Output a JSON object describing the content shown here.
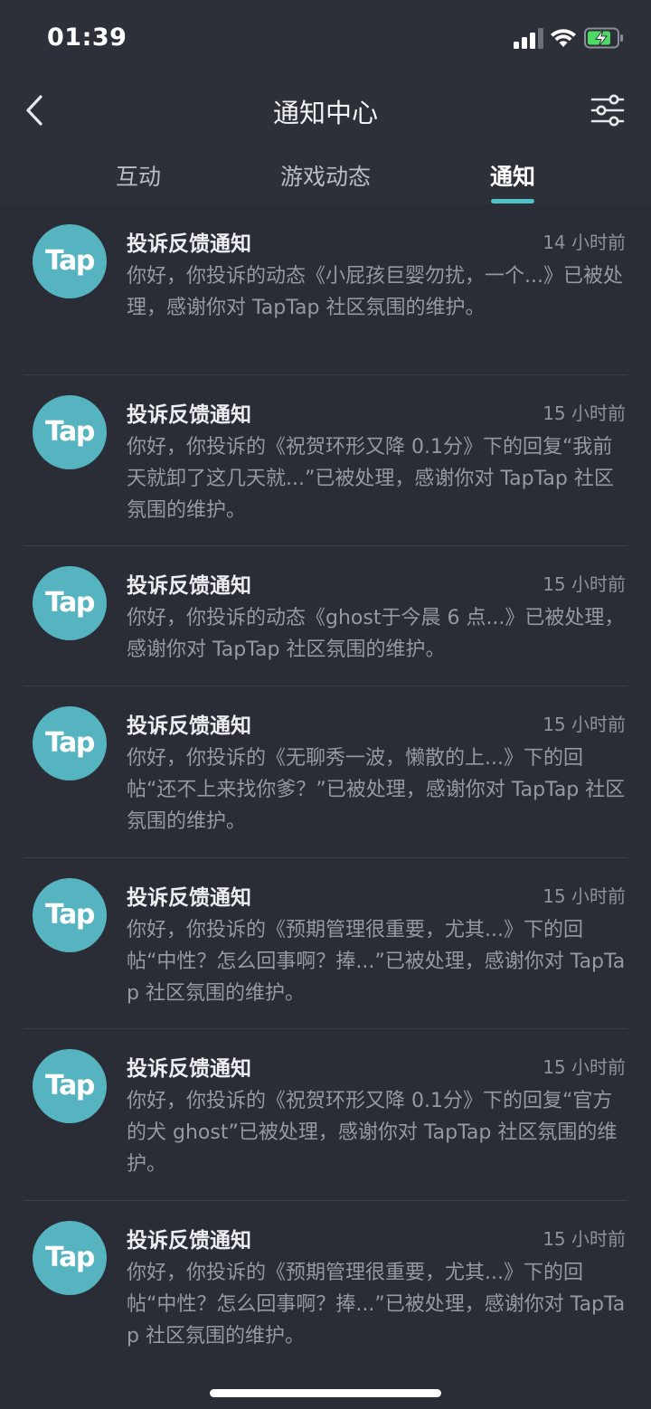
{
  "status_bar": {
    "time": "01:39",
    "icons": [
      "signal-icon",
      "wifi-icon",
      "battery-charging-icon"
    ]
  },
  "nav": {
    "back_icon": "chevron-left-icon",
    "title": "通知中心",
    "filter_icon": "sliders-icon"
  },
  "tabs": [
    {
      "label": "互动",
      "active": false
    },
    {
      "label": "游戏动态",
      "active": false
    },
    {
      "label": "通知",
      "active": true
    }
  ],
  "colors": {
    "accent": "#4ec3c9",
    "avatar": "#56b4c1",
    "background": "#2a2d35",
    "battery": "#4cd964"
  },
  "notifications": [
    {
      "avatar": "Tap",
      "title": "投诉反馈通知",
      "time": "14 小时前",
      "body": "你好，你投诉的动态《小屁孩巨婴勿扰，一个...》已被处理，感谢你对 TapTap 社区氛围的维护。"
    },
    {
      "avatar": "Tap",
      "title": "投诉反馈通知",
      "time": "15 小时前",
      "body": "你好，你投诉的《祝贺环形又降 0.1分》下的回复“我前天就卸了这几天就...”已被处理，感谢你对 TapTap 社区氛围的维护。"
    },
    {
      "avatar": "Tap",
      "title": "投诉反馈通知",
      "time": "15 小时前",
      "body": "你好，你投诉的动态《ghost于今晨 6 点...》已被处理，感谢你对 TapTap 社区氛围的维护。"
    },
    {
      "avatar": "Tap",
      "title": "投诉反馈通知",
      "time": "15 小时前",
      "body": "你好，你投诉的《无聊秀一波，懒散的上...》下的回帖“还不上来找你爹？”已被处理，感谢你对 TapTap 社区氛围的维护。"
    },
    {
      "avatar": "Tap",
      "title": "投诉反馈通知",
      "time": "15 小时前",
      "body": "你好，你投诉的《预期管理很重要，尤其...》下的回帖“中性？怎么回事啊？捧...”已被处理，感谢你对 TapTap 社区氛围的维护。"
    },
    {
      "avatar": "Tap",
      "title": "投诉反馈通知",
      "time": "15 小时前",
      "body": "你好，你投诉的《祝贺环形又降 0.1分》下的回复“官方的犬 ghost”已被处理，感谢你对 TapTap 社区氛围的维护。"
    },
    {
      "avatar": "Tap",
      "title": "投诉反馈通知",
      "time": "15 小时前",
      "body": "你好，你投诉的《预期管理很重要，尤其...》下的回帖“中性？怎么回事啊？捧...”已被处理，感谢你对 TapTap 社区氛围的维护。"
    }
  ]
}
